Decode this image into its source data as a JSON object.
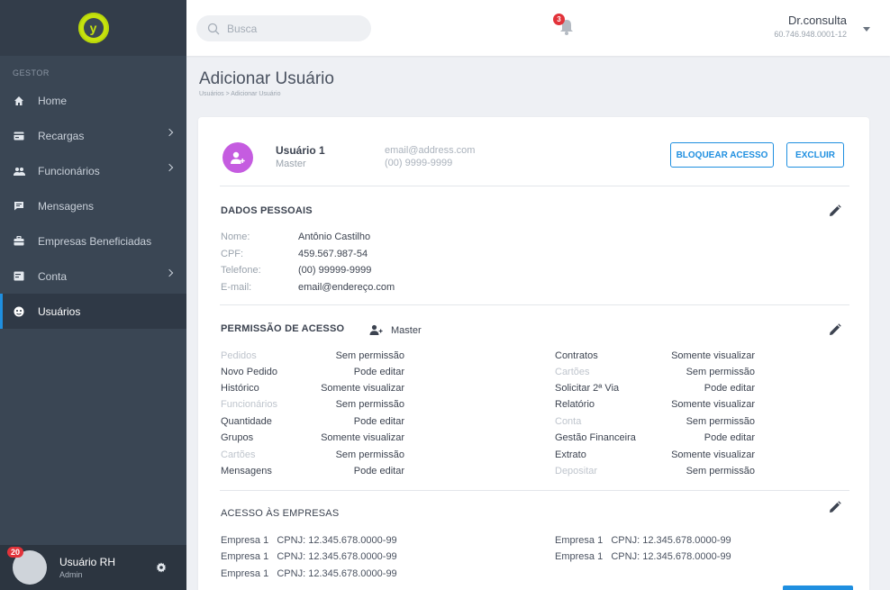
{
  "sidebar": {
    "section_label": "GESTOR",
    "logo_letter": "y",
    "items": [
      {
        "label": "Home",
        "icon": "home-icon",
        "has_chevron": false
      },
      {
        "label": "Recargas",
        "icon": "card-icon",
        "has_chevron": true
      },
      {
        "label": "Funcionários",
        "icon": "people-icon",
        "has_chevron": true
      },
      {
        "label": "Mensagens",
        "icon": "message-icon",
        "has_chevron": false
      },
      {
        "label": "Empresas Beneficiadas",
        "icon": "briefcase-icon",
        "has_chevron": false
      },
      {
        "label": "Conta",
        "icon": "wallet-icon",
        "has_chevron": true
      },
      {
        "label": "Usuários",
        "icon": "user-circle-icon",
        "has_chevron": false,
        "active": true
      }
    ],
    "user": {
      "name": "Usuário RH",
      "role": "Admin",
      "badge": "20"
    }
  },
  "header": {
    "search_placeholder": "Busca",
    "notifications": "3",
    "account_name": "Dr.consulta",
    "account_cnpj": "60.746.948.0001-12"
  },
  "page": {
    "title": "Adicionar Usuário",
    "breadcrumb": "Usuários > Adicionar Usuário"
  },
  "profile": {
    "name": "Usuário 1",
    "role": "Master",
    "email": "email@address.com",
    "phone": "(00) 9999-9999",
    "block_label": "BLOQUEAR ACESSO",
    "delete_label": "EXCLUIR"
  },
  "personal": {
    "title": "DADOS PESSOAIS",
    "fields": [
      {
        "label": "Nome:",
        "value": "Antônio Castilho"
      },
      {
        "label": "CPF:",
        "value": "459.567.987-54"
      },
      {
        "label": "Telefone:",
        "value": "(00) 99999-9999"
      },
      {
        "label": "E-mail:",
        "value": "email@endereço.com"
      }
    ]
  },
  "permissions": {
    "title": "PERMISSÃO DE ACESSO",
    "role": "Master",
    "left": [
      {
        "name": "Pedidos",
        "value": "Sem permissão",
        "enabled": false
      },
      {
        "name": "Novo Pedido",
        "value": "Pode editar",
        "enabled": true
      },
      {
        "name": "Histórico",
        "value": "Somente visualizar",
        "enabled": true
      },
      {
        "name": "Funcionários",
        "value": "Sem permissão",
        "enabled": false
      },
      {
        "name": "Quantidade",
        "value": "Pode editar",
        "enabled": true
      },
      {
        "name": "Grupos",
        "value": "Somente visualizar",
        "enabled": true
      },
      {
        "name": "Cartões",
        "value": "Sem permissão",
        "enabled": false
      },
      {
        "name": "Mensagens",
        "value": "Pode editar",
        "enabled": true
      }
    ],
    "right": [
      {
        "name": "Contratos",
        "value": "Somente visualizar",
        "enabled": true
      },
      {
        "name": "Cartões",
        "value": "Sem permissão",
        "enabled": false
      },
      {
        "name": "Solicitar 2ª Via",
        "value": "Pode editar",
        "enabled": true
      },
      {
        "name": "Relatório",
        "value": "Somente visualizar",
        "enabled": true
      },
      {
        "name": "Conta",
        "value": "Sem permissão",
        "enabled": false
      },
      {
        "name": "Gestão Financeira",
        "value": "Pode editar",
        "enabled": true
      },
      {
        "name": "Extrato",
        "value": "Somente visualizar",
        "enabled": true
      },
      {
        "name": "Depositar",
        "value": "Sem permissão",
        "enabled": false
      }
    ]
  },
  "companies": {
    "title": "ACESSO ÀS EMPRESAS",
    "left": [
      "Empresa 1   CPNJ: 12.345.678.0000-99",
      "Empresa 1   CPNJ: 12.345.678.0000-99",
      "Empresa 1   CPNJ: 12.345.678.0000-99"
    ],
    "right": [
      "Empresa 1   CPNJ: 12.345.678.0000-99",
      "Empresa 1   CPNJ: 12.345.678.0000-99"
    ]
  },
  "colors": {
    "accent": "#1f8fe0",
    "sidebar": "#3a4654",
    "avatar": "#c55ce0",
    "logo": "#c6e20d",
    "badge": "#e2333a"
  }
}
